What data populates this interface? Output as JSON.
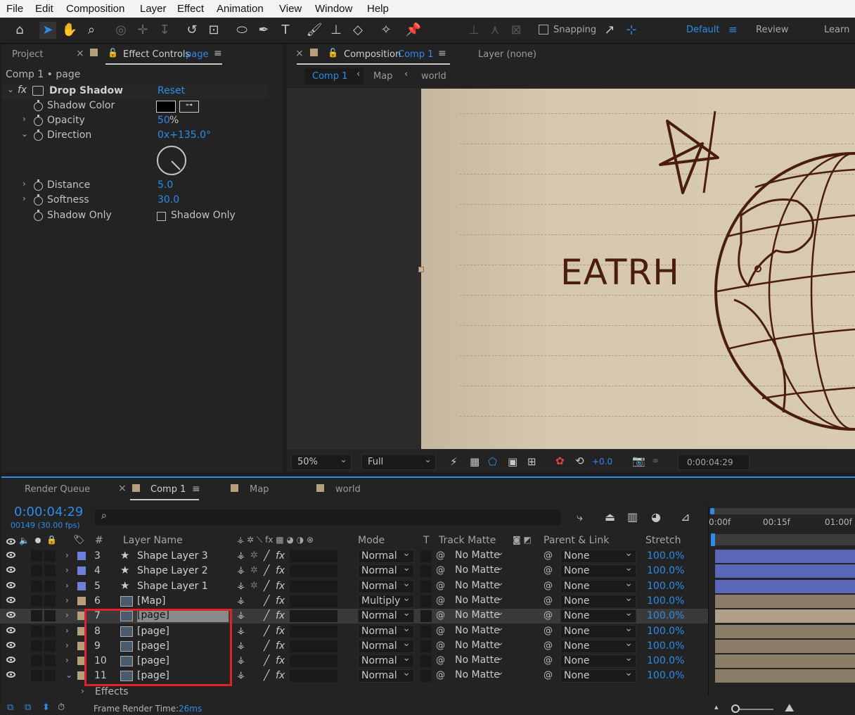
{
  "menu": [
    "File",
    "Edit",
    "Composition",
    "Layer",
    "Effect",
    "Animation",
    "View",
    "Window",
    "Help"
  ],
  "toolbar": {
    "snapping": "Snapping",
    "workspaces": [
      "Default",
      "Review",
      "Learn"
    ]
  },
  "left_panel": {
    "tab_project": "Project",
    "tab_effect_controls": "Effect Controls",
    "tab_effect_target": "page",
    "breadcrumb": "Comp 1 • page",
    "effect_name": "Drop Shadow",
    "reset": "Reset",
    "props": {
      "shadow_color": "Shadow Color",
      "opacity": "Opacity",
      "opacity_val": "50",
      "opacity_unit": "%",
      "direction": "Direction",
      "direction_val": "0x+135.0°",
      "distance": "Distance",
      "distance_val": "5.0",
      "softness": "Softness",
      "softness_val": "30.0",
      "shadow_only": "Shadow Only",
      "shadow_only_cb": "Shadow Only"
    }
  },
  "comp_panel": {
    "tab_label": "Composition",
    "tab_comp": "Comp 1",
    "layer_tab": "Layer (none)",
    "crumbs": [
      "Comp 1",
      "Map",
      "world"
    ],
    "art_text": "EATRH",
    "zoom": "50%",
    "resolution": "Full",
    "exposure": "+0.0",
    "timecode": "0:00:04:29"
  },
  "timeline": {
    "tabs": [
      "Render Queue",
      "Comp 1",
      "Map",
      "world"
    ],
    "timecode": "0:00:04:29",
    "frames": "00149 (30.00 fps)",
    "search_placeholder": "",
    "headers": {
      "num": "#",
      "layer_name": "Layer Name",
      "mode": "Mode",
      "t": "T",
      "track_matte": "Track Matte",
      "parent": "Parent & Link",
      "stretch": "Stretch"
    },
    "ruler": [
      "0:00f",
      "00:15f",
      "01:00f"
    ],
    "layers": [
      {
        "num": "3",
        "name": "Shape Layer 3",
        "type": "shape",
        "mode": "Normal",
        "matte": "No Matte",
        "parent": "None",
        "stretch": "100.0%",
        "color": "#6f7fd8"
      },
      {
        "num": "4",
        "name": "Shape Layer 2",
        "type": "shape",
        "mode": "Normal",
        "matte": "No Matte",
        "parent": "None",
        "stretch": "100.0%",
        "color": "#6f7fd8"
      },
      {
        "num": "5",
        "name": "Shape Layer 1",
        "type": "shape",
        "mode": "Normal",
        "matte": "No Matte",
        "parent": "None",
        "stretch": "100.0%",
        "color": "#6f7fd8"
      },
      {
        "num": "6",
        "name": "[Map]",
        "type": "comp",
        "mode": "Multiply",
        "matte": "No Matte",
        "parent": "None",
        "stretch": "100.0%",
        "color": "#b59f7d"
      },
      {
        "num": "7",
        "name": "[page]",
        "type": "comp",
        "mode": "Normal",
        "matte": "No Matte",
        "parent": "None",
        "stretch": "100.0%",
        "color": "#b59f7d"
      },
      {
        "num": "8",
        "name": "[page]",
        "type": "comp",
        "mode": "Normal",
        "matte": "No Matte",
        "parent": "None",
        "stretch": "100.0%",
        "color": "#b59f7d"
      },
      {
        "num": "9",
        "name": "[page]",
        "type": "comp",
        "mode": "Normal",
        "matte": "No Matte",
        "parent": "None",
        "stretch": "100.0%",
        "color": "#b59f7d"
      },
      {
        "num": "10",
        "name": "[page]",
        "type": "comp",
        "mode": "Normal",
        "matte": "No Matte",
        "parent": "None",
        "stretch": "100.0%",
        "color": "#b59f7d"
      },
      {
        "num": "11",
        "name": "[page]",
        "type": "comp",
        "mode": "Normal",
        "matte": "No Matte",
        "parent": "None",
        "stretch": "100.0%",
        "color": "#b59f7d"
      }
    ],
    "effects_label": "Effects",
    "render_time_label": "Frame Render Time:",
    "render_time": "26ms"
  }
}
